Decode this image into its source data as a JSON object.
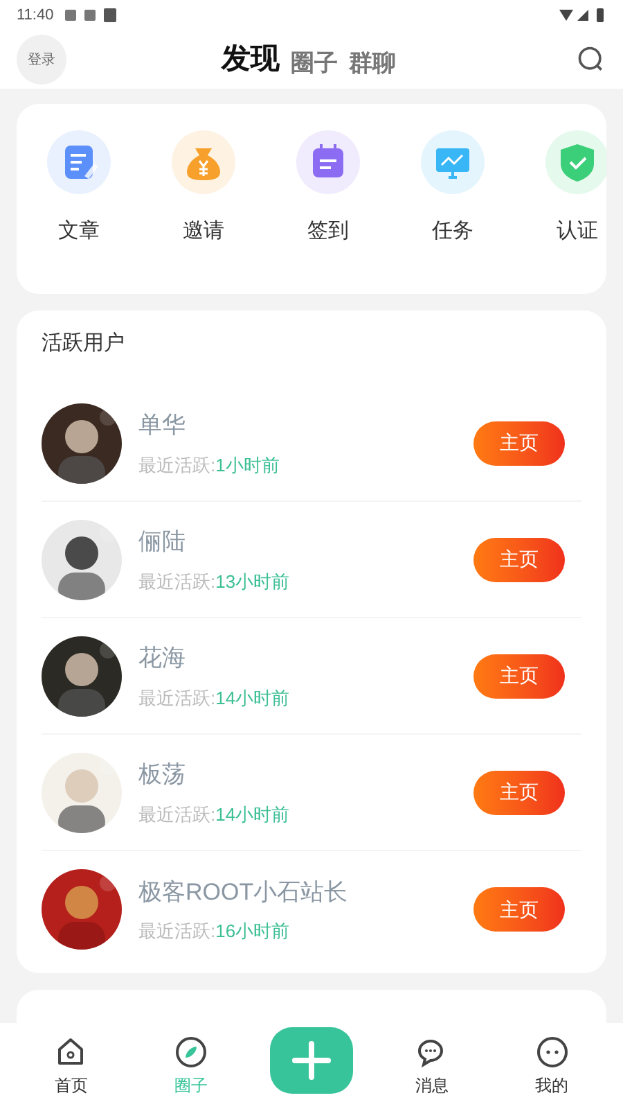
{
  "status_bar": {
    "time": "11:40"
  },
  "header": {
    "login": "登录",
    "tabs": [
      {
        "label": "发现",
        "selected": true
      },
      {
        "label": "圈子",
        "selected": false
      },
      {
        "label": "群聊",
        "selected": false
      }
    ]
  },
  "shortcuts": [
    {
      "label": "文章",
      "kind": "article",
      "color": "#5b8ff9"
    },
    {
      "label": "邀请",
      "kind": "money",
      "color": "#f7a12c"
    },
    {
      "label": "签到",
      "kind": "calendar",
      "color": "#8b6cf2"
    },
    {
      "label": "任务",
      "kind": "monitor",
      "color": "#38b6f5"
    },
    {
      "label": "认证",
      "kind": "shield",
      "color": "#3ccf7a"
    }
  ],
  "active_users": {
    "title": "活跃用户",
    "users": [
      {
        "name": "单华",
        "prefix": "最近活跃:",
        "time": "1小时前",
        "button": "主页"
      },
      {
        "name": "俪陆",
        "prefix": "最近活跃:",
        "time": "13小时前",
        "button": "主页"
      },
      {
        "name": "花海",
        "prefix": "最近活跃:",
        "time": "14小时前",
        "button": "主页"
      },
      {
        "name": "板荡",
        "prefix": "最近活跃:",
        "time": "14小时前",
        "button": "主页"
      },
      {
        "name": "极客ROOT小石站长",
        "prefix": "最近活跃:",
        "time": "16小时前",
        "button": "主页"
      }
    ]
  },
  "bottom_nav": [
    {
      "label": "首页",
      "kind": "home",
      "selected": false
    },
    {
      "label": "圈子",
      "kind": "compass",
      "selected": true
    },
    {
      "kind": "add"
    },
    {
      "label": "消息",
      "kind": "chat",
      "selected": false
    },
    {
      "label": "我的",
      "kind": "face",
      "selected": false
    }
  ]
}
